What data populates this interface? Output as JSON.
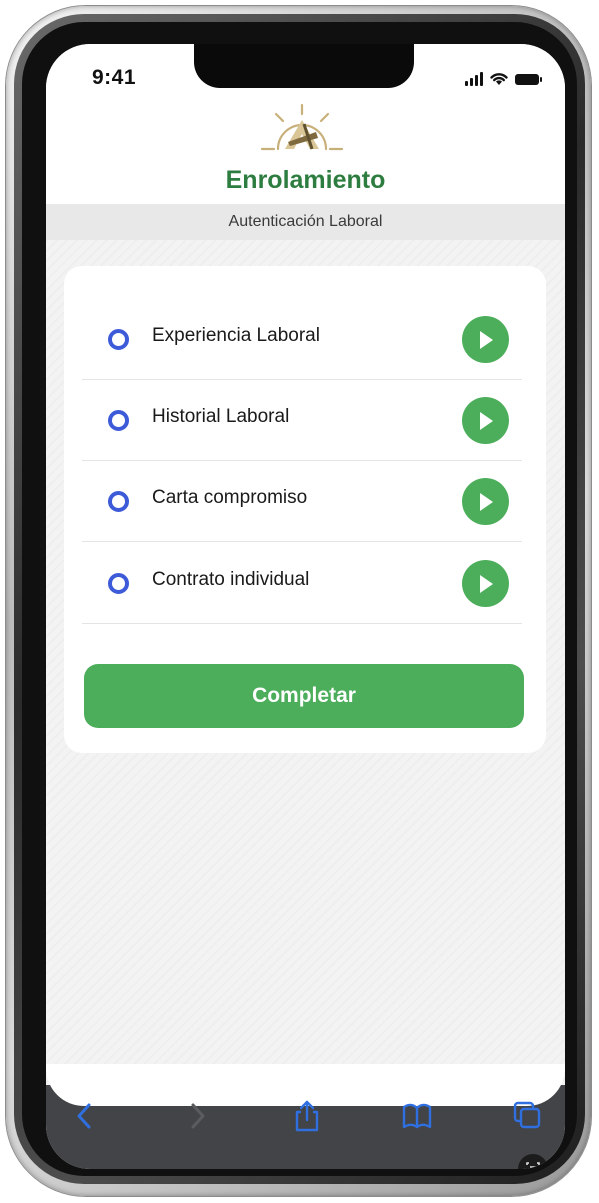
{
  "status_bar": {
    "time": "9:41"
  },
  "header": {
    "title": "Enrolamiento",
    "subtitle": "Autenticación Laboral",
    "logo_icon": "helm-logo-icon"
  },
  "tasks": [
    {
      "label": "Experiencia Laboral",
      "icon": "play-icon"
    },
    {
      "label": "Historial Laboral",
      "icon": "play-icon"
    },
    {
      "label": "Carta compromiso",
      "icon": "play-icon"
    },
    {
      "label": "Contrato individual",
      "icon": "play-icon"
    }
  ],
  "actions": {
    "complete_label": "Completar"
  },
  "browser_toolbar": {
    "icons": [
      "back-icon",
      "forward-icon",
      "share-icon",
      "bookmarks-icon",
      "tabs-icon",
      "scan-text-icon"
    ]
  },
  "colors": {
    "brand_green": "#2e7d40",
    "button_green": "#4cae5b",
    "radio_blue": "#3d5bd9",
    "toolbar_blue": "#2f6fe0",
    "toolbar_bg": "#424447"
  }
}
